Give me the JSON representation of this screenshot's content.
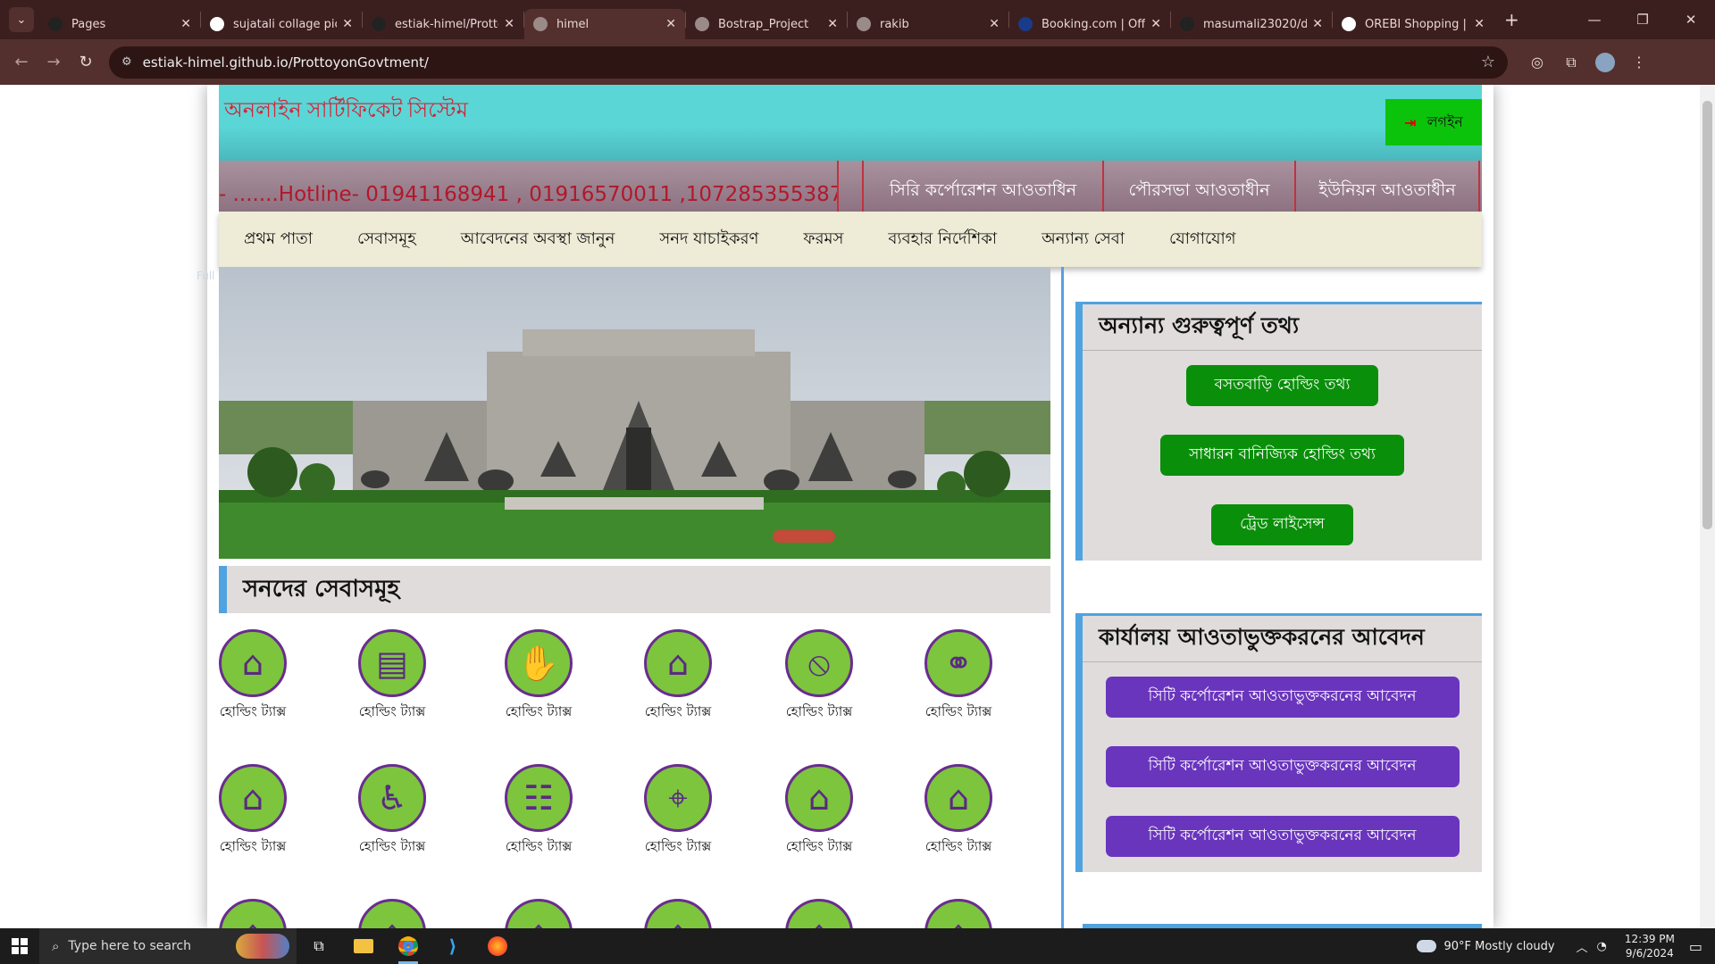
{
  "browser": {
    "tabs": [
      {
        "title": "Pages",
        "favicon": "github-icon",
        "color": "#222222"
      },
      {
        "title": "sujatali collage pic",
        "favicon": "google-icon",
        "color": "#ffffff"
      },
      {
        "title": "estiak-himel/Prottoy",
        "favicon": "github-icon",
        "color": "#222222"
      },
      {
        "title": "himel",
        "favicon": "globe-icon",
        "color": "#9a8a88",
        "active": true
      },
      {
        "title": "Bostrap_Project",
        "favicon": "globe-icon",
        "color": "#9a8a88"
      },
      {
        "title": "rakib",
        "favicon": "globe-icon",
        "color": "#9a8a88"
      },
      {
        "title": "Booking.com | Offi",
        "favicon": "booking-icon",
        "color": "#1a3a8a"
      },
      {
        "title": "masumali23020/d",
        "favicon": "github-icon",
        "color": "#222222"
      },
      {
        "title": "OREBI Shopping |",
        "favicon": "orebi-icon",
        "color": "#ffffff"
      }
    ],
    "url": "estiak-himel.github.io/ProttoyonGovtment/"
  },
  "site": {
    "title": "অনলাইন সার্টিফিকেট সিস্টেম",
    "login_label": "লগইন",
    "hotline": "- .......Hotline- 01941168941 , 01916570011 ,107285355387",
    "band_links": [
      "সিরি কর্পোরেশন আওতাধিন",
      "পৌরসভা আওতাধীন",
      "ইউনিয়ন আওতাধীন"
    ],
    "menu": [
      "প্রথম পাতা",
      "সেবাসমূহ",
      "আবেদনের অবস্থা জানুন",
      "সনদ যাচাইকরণ",
      "ফরমস",
      "ব্যবহার নির্দেশিকা",
      "অন্যান্য সেবা",
      "যোগাযোগ"
    ],
    "faint_text": "Full Screen Slid"
  },
  "services": {
    "heading": "সনদের সেবাসমূহ",
    "items": [
      {
        "icon": "house-tax-icon",
        "label": "হোল্ডিং ট্যাক্স"
      },
      {
        "icon": "id-card-icon",
        "label": "হোল্ডিং ট্যাক্স"
      },
      {
        "icon": "hand-money-icon",
        "label": "হোল্ডিং ট্যাক্স"
      },
      {
        "icon": "family-house-icon",
        "label": "হোল্ডিং ট্যাক্স"
      },
      {
        "icon": "no-couple-icon",
        "label": "হোল্ডিং ট্যাক্স"
      },
      {
        "icon": "wedding-couple-icon",
        "label": "হোল্ডিং ট্যাক্স"
      },
      {
        "icon": "house-tax-icon",
        "label": "হোল্ডিং ট্যাক্স"
      },
      {
        "icon": "wheelchair-icon",
        "label": "হোল্ডিং ট্যাক্স"
      },
      {
        "icon": "people-document-icon",
        "label": "হোল্ডিং ট্যাক্স"
      },
      {
        "icon": "location-pin-icon",
        "label": "হোল্ডিং ট্যাক্স"
      },
      {
        "icon": "house-tax-icon",
        "label": "হোল্ডিং ট্যাক্স"
      },
      {
        "icon": "house-tax-icon",
        "label": "হোল্ডিং ট্যাক্স"
      },
      {
        "icon": "house-tax-icon",
        "label": ""
      },
      {
        "icon": "house-tax-icon",
        "label": ""
      },
      {
        "icon": "house-tax-icon",
        "label": ""
      },
      {
        "icon": "house-tax-icon",
        "label": ""
      },
      {
        "icon": "house-tax-icon",
        "label": ""
      },
      {
        "icon": "house-tax-icon",
        "label": ""
      }
    ]
  },
  "sidebar": {
    "info_title": "অন্যান্য গুরুত্বপূর্ণ তথ্য",
    "info_buttons": [
      "বসতবাড়ি হোল্ডিং তথ্য",
      "সাধারন বানিজ্যিক হোল্ডিং তথ্য",
      "ট্রেড লাইসেন্স"
    ],
    "office_title": "কার্যালয় আওতাভুক্তকরনের আবেদন",
    "office_buttons": [
      "সিটি কর্পোরেশন আওতাভুক্তকরনের আবেদন",
      "সিটি কর্পোরেশন আওতাভুক্তকরনের আবেদন",
      "সিটি কর্পোরেশন আওতাভুক্তকরনের আবেদন"
    ]
  },
  "taskbar": {
    "search_placeholder": "Type here to search",
    "weather": "90°F  Mostly cloudy",
    "time": "12:39 PM",
    "date": "9/6/2024"
  },
  "colors": {
    "header_bg": "#5bd6d6",
    "title_red": "#d3263a",
    "login_green": "#0cc30c",
    "icon_green": "#7cc53d",
    "icon_border": "#6a2c8f",
    "btn_green": "#0a8f0a",
    "btn_purple": "#6a35bd",
    "accent_blue": "#4fa3df"
  }
}
